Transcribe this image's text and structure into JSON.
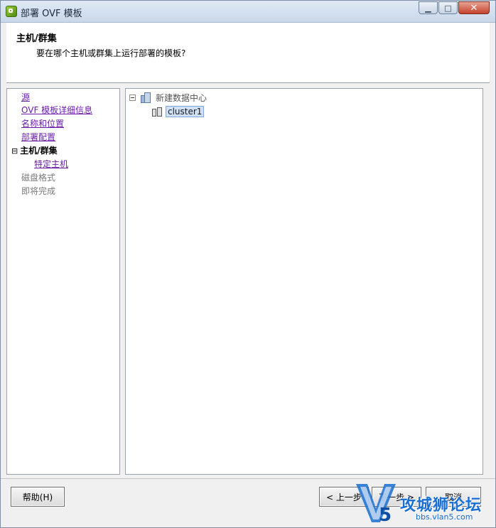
{
  "window": {
    "title": "部署 OVF 模板",
    "buttons": {
      "minimize": "▁",
      "maximize": "□",
      "close": "✕"
    }
  },
  "header": {
    "title": "主机/群集",
    "subtitle": "要在哪个主机或群集上运行部署的模板?"
  },
  "nav": {
    "items": [
      {
        "label": "源",
        "state": "link"
      },
      {
        "label": "OVF 模板详细信息",
        "state": "link"
      },
      {
        "label": "名称和位置",
        "state": "link"
      },
      {
        "label": "部署配置",
        "state": "link"
      },
      {
        "label": "主机/群集",
        "state": "current",
        "expander": "⊟"
      },
      {
        "label": "特定主机",
        "state": "link-sub"
      },
      {
        "label": "磁盘格式",
        "state": "disabled"
      },
      {
        "label": "即将完成",
        "state": "disabled"
      }
    ]
  },
  "tree": {
    "datacenter": {
      "label": "新建数据中心",
      "icon": "datacenter-icon"
    },
    "cluster": {
      "label": "cluster1",
      "icon": "cluster-icon",
      "selected": true
    }
  },
  "footer": {
    "help": "帮助(H)",
    "back": "< 上一步",
    "next": "下一步 >",
    "cancel": "取消"
  },
  "watermark": {
    "text": "攻城狮论坛",
    "url": "bbs.vlan5.com"
  },
  "colors": {
    "link": "#6b1fa8",
    "disabled": "#7a7a7a",
    "selection_bg": "#cfe0f5",
    "watermark": "#1a6fd0"
  }
}
